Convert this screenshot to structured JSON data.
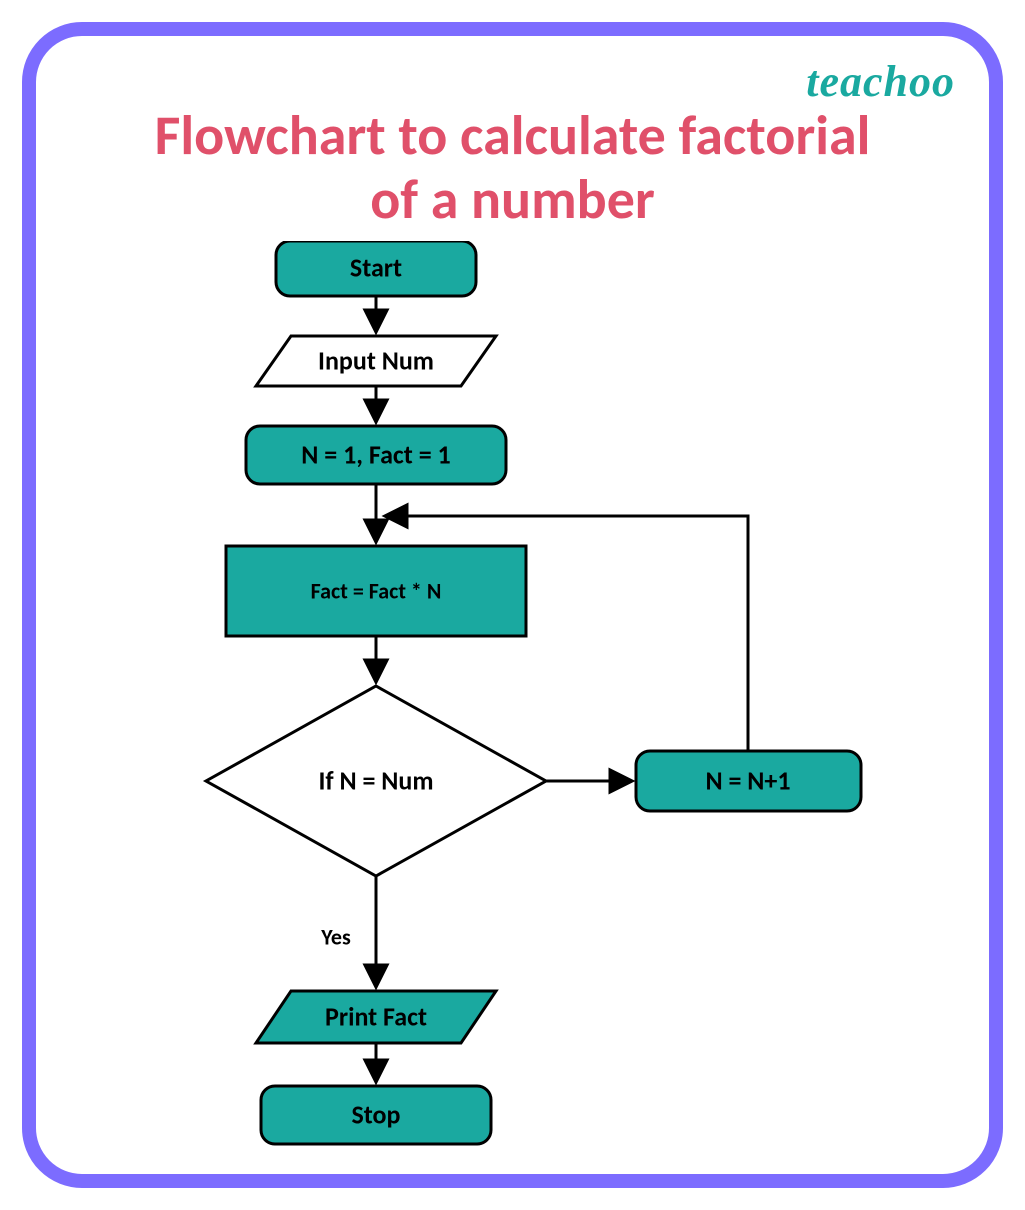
{
  "brand": "teachoo",
  "title_line1": "Flowchart to calculate factorial",
  "title_line2": "of a number",
  "colors": {
    "border": "#7c6cff",
    "node_fill": "#1aa9a0",
    "node_stroke": "#000000",
    "title_color": "#e0506a"
  },
  "flow": {
    "start": "Start",
    "input": "Input Num",
    "init": "N = 1, Fact = 1",
    "process": "Fact = Fact * N",
    "decision": "If  N = Num",
    "increment": "N = N+1",
    "yes_label": "Yes",
    "output": "Print Fact",
    "stop": "Stop"
  }
}
